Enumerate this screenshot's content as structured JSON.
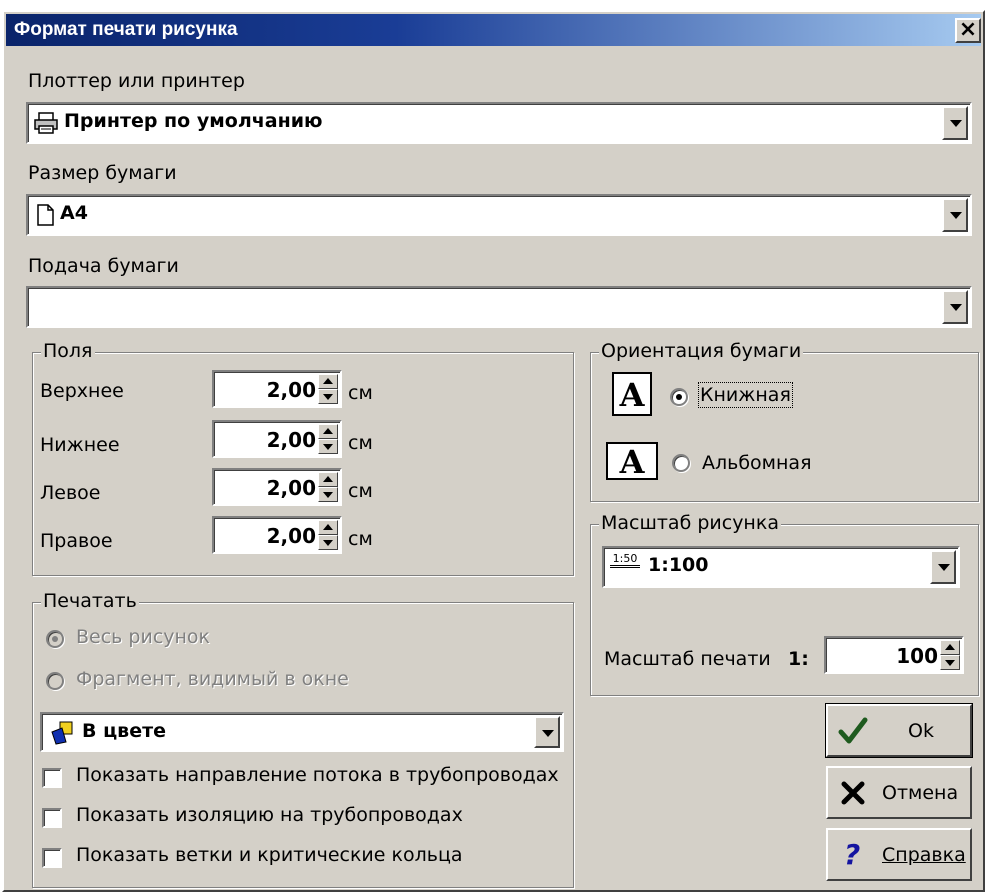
{
  "window": {
    "title": "Формат печати рисунка",
    "close_label": "×"
  },
  "printer": {
    "label": "Плоттер или принтер",
    "value": "Принтер по умолчанию",
    "icon": "printer-icon"
  },
  "paper_size": {
    "label": "Размер бумаги",
    "value": "A4",
    "icon": "page-icon"
  },
  "paper_feed": {
    "label": "Подача бумаги",
    "value": ""
  },
  "margins": {
    "title": "Поля",
    "unit": "см",
    "items": [
      {
        "label": "Верхнее",
        "value": "2,00"
      },
      {
        "label": "Нижнее",
        "value": "2,00"
      },
      {
        "label": "Левое",
        "value": "2,00"
      },
      {
        "label": "Правое",
        "value": "2,00"
      }
    ]
  },
  "orientation": {
    "title": "Ориентация бумаги",
    "portrait_label": "Книжная",
    "landscape_label": "Альбомная",
    "icon_letter": "A",
    "selected": "portrait"
  },
  "scale": {
    "title": "Масштаб рисунка",
    "value": "1:100",
    "icon_text": "1:50",
    "print_scale_label": "Масштаб печати",
    "print_scale_prefix": "1:",
    "print_scale_value": "100"
  },
  "print": {
    "title": "Печатать",
    "option_all": "Весь рисунок",
    "option_fragment": "Фрагмент, видимый в окне",
    "color_value": "В цвете",
    "checkboxes": [
      {
        "label": "Показать направление потока в трубопроводах",
        "checked": false
      },
      {
        "label": "Показать изоляцию на трубопроводах",
        "checked": false
      },
      {
        "label": "Показать ветки и критические кольца",
        "checked": false
      }
    ]
  },
  "buttons": {
    "ok": "Ok",
    "cancel": "Отмена",
    "help": "Справка"
  },
  "colors": {
    "title_start": "#0a246a",
    "title_end": "#a6caf0",
    "face": "#d4d0c8",
    "ok_check": "#1e5a1e",
    "cancel_x": "#000000",
    "help_q": "#1414a0"
  }
}
